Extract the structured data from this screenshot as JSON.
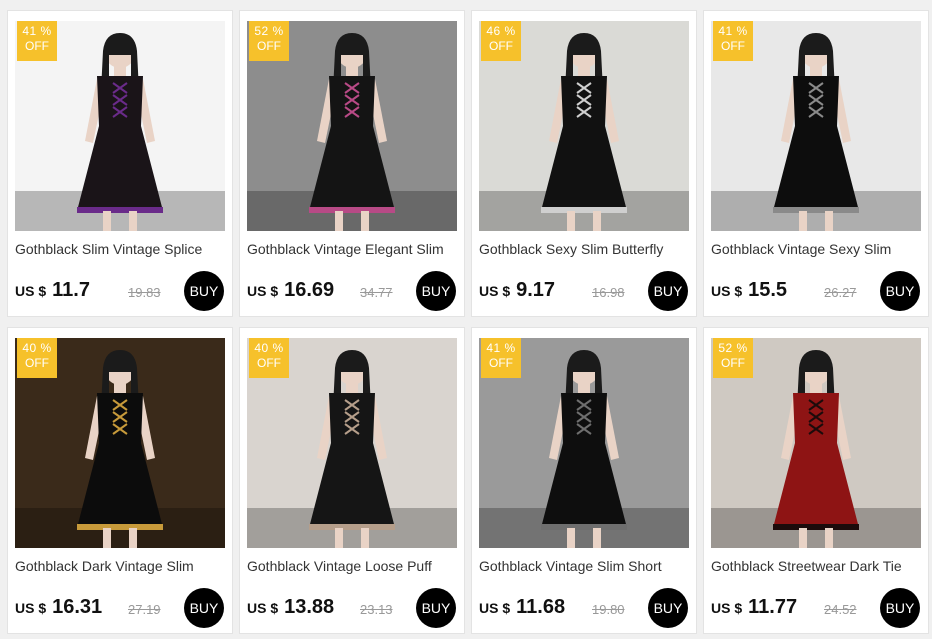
{
  "products": [
    {
      "title": "Gothblack Slim Vintage Splice",
      "discount_pct": "41 %",
      "discount_off": "OFF",
      "currency": "US $",
      "price": "11.7",
      "old_price": "19.83",
      "buy_label": "BUY",
      "bg": "#f4f4f4",
      "dress": "#1a1418",
      "accent": "#6a2b8a"
    },
    {
      "title": "Gothblack Vintage Elegant Slim",
      "discount_pct": "52 %",
      "discount_off": "OFF",
      "currency": "US $",
      "price": "16.69",
      "old_price": "34.77",
      "buy_label": "BUY",
      "bg": "#8d8d8d",
      "dress": "#141414",
      "accent": "#b84a86"
    },
    {
      "title": "Gothblack Sexy Slim Butterfly",
      "discount_pct": "46 %",
      "discount_off": "OFF",
      "currency": "US $",
      "price": "9.17",
      "old_price": "16.98",
      "buy_label": "BUY",
      "bg": "#dadad6",
      "dress": "#111111",
      "accent": "#cfcfcf"
    },
    {
      "title": "Gothblack Vintage Sexy Slim",
      "discount_pct": "41 %",
      "discount_off": "OFF",
      "currency": "US $",
      "price": "15.5",
      "old_price": "26.27",
      "buy_label": "BUY",
      "bg": "#e8e8e8",
      "dress": "#0d0d0d",
      "accent": "#8a8a8a"
    },
    {
      "title": "Gothblack Dark Vintage Slim",
      "discount_pct": "40 %",
      "discount_off": "OFF",
      "currency": "US $",
      "price": "16.31",
      "old_price": "27.19",
      "buy_label": "BUY",
      "bg": "#3a2a1a",
      "dress": "#0c0c0c",
      "accent": "#c79a3a"
    },
    {
      "title": "Gothblack Vintage Loose Puff",
      "discount_pct": "40 %",
      "discount_off": "OFF",
      "currency": "US $",
      "price": "13.88",
      "old_price": "23.13",
      "buy_label": "BUY",
      "bg": "#d9d4cf",
      "dress": "#151515",
      "accent": "#b59e8a"
    },
    {
      "title": "Gothblack Vintage Slim Short",
      "discount_pct": "41 %",
      "discount_off": "OFF",
      "currency": "US $",
      "price": "11.68",
      "old_price": "19.80",
      "buy_label": "BUY",
      "bg": "#9a9a9a",
      "dress": "#0e0e0e",
      "accent": "#6e6e6e"
    },
    {
      "title": "Gothblack Streetwear Dark Tie",
      "discount_pct": "52 %",
      "discount_off": "OFF",
      "currency": "US $",
      "price": "11.77",
      "old_price": "24.52",
      "buy_label": "BUY",
      "bg": "#cfc9c2",
      "dress": "#8e1414",
      "accent": "#1c0b0b"
    }
  ]
}
